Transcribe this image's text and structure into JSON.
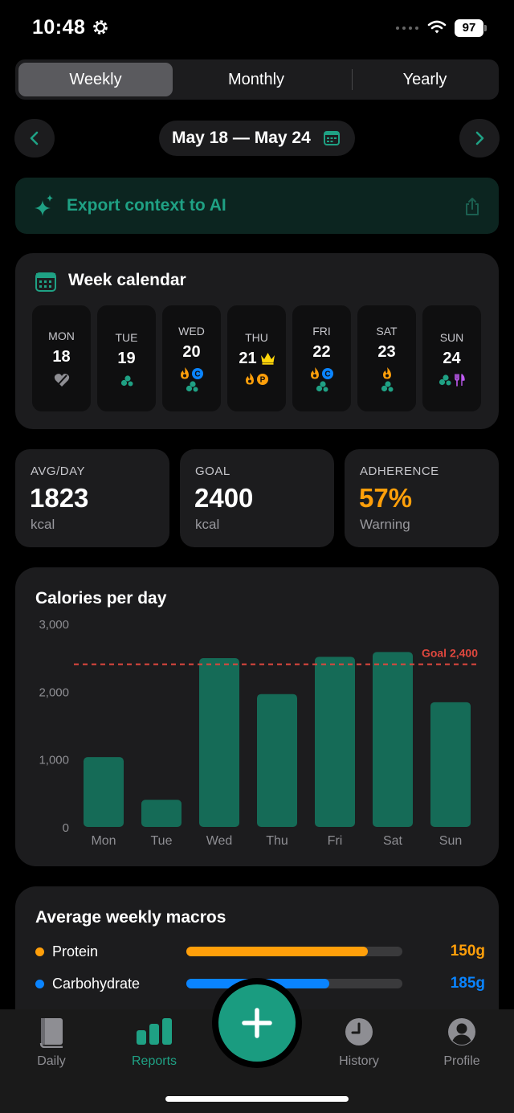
{
  "status": {
    "time": "10:48",
    "battery": "97"
  },
  "tabs": [
    "Weekly",
    "Monthly",
    "Yearly"
  ],
  "active_tab": "Weekly",
  "date_range": "May 18 — May 24",
  "export": {
    "label": "Export context to AI"
  },
  "week_calendar": {
    "title": "Week calendar",
    "days": [
      {
        "name": "MON",
        "num": "18",
        "icons": [
          "broken-heart-icon"
        ]
      },
      {
        "name": "TUE",
        "num": "19",
        "icons": [
          "pills-icon"
        ]
      },
      {
        "name": "WED",
        "num": "20",
        "icons": [
          "flame-icon",
          "c-badge-icon",
          "pills-icon"
        ]
      },
      {
        "name": "THU",
        "num": "21",
        "icons": [
          "crown-icon",
          "flame-icon",
          "p-badge-icon"
        ]
      },
      {
        "name": "FRI",
        "num": "22",
        "icons": [
          "flame-icon",
          "c-badge-icon",
          "pills-icon"
        ]
      },
      {
        "name": "SAT",
        "num": "23",
        "icons": [
          "flame-icon",
          "pills-icon"
        ]
      },
      {
        "name": "SUN",
        "num": "24",
        "icons": [
          "pills-icon",
          "fork-knife-icon"
        ]
      }
    ]
  },
  "stats": {
    "avg": {
      "label": "AVG/DAY",
      "value": "1823",
      "unit": "kcal"
    },
    "goal": {
      "label": "GOAL",
      "value": "2400",
      "unit": "kcal"
    },
    "adherence": {
      "label": "ADHERENCE",
      "value": "57%",
      "unit": "Warning"
    }
  },
  "chart_data": {
    "type": "bar",
    "title": "Calories per day",
    "categories": [
      "Mon",
      "Tue",
      "Wed",
      "Thu",
      "Fri",
      "Sat",
      "Sun"
    ],
    "values": [
      1030,
      400,
      2490,
      1960,
      2510,
      2580,
      1840
    ],
    "ylim": [
      0,
      3000
    ],
    "yticks": [
      "0",
      "1,000",
      "2,000",
      "3,000"
    ],
    "goal_value": 2400,
    "goal_label": "Goal 2,400",
    "grid": false,
    "colors": {
      "bar": "#156b57",
      "goal": "#e0473e"
    }
  },
  "macros": {
    "title": "Average weekly macros",
    "items": [
      {
        "name": "Protein",
        "amount": "150g",
        "fraction": 0.84,
        "color": "#ff9f0a"
      },
      {
        "name": "Carbohydrate",
        "amount": "185g",
        "fraction": 0.66,
        "color": "#0a84ff"
      }
    ]
  },
  "tabbar": {
    "items": [
      {
        "label": "Daily",
        "icon": "book-icon"
      },
      {
        "label": "Reports",
        "icon": "bar-chart-icon"
      },
      {
        "label": "History",
        "icon": "clock-icon"
      },
      {
        "label": "Profile",
        "icon": "person-icon"
      }
    ],
    "active": "Reports"
  },
  "colors": {
    "accent": "#1fa184",
    "warning": "#ff9f0a",
    "card": "#1c1c1e"
  }
}
